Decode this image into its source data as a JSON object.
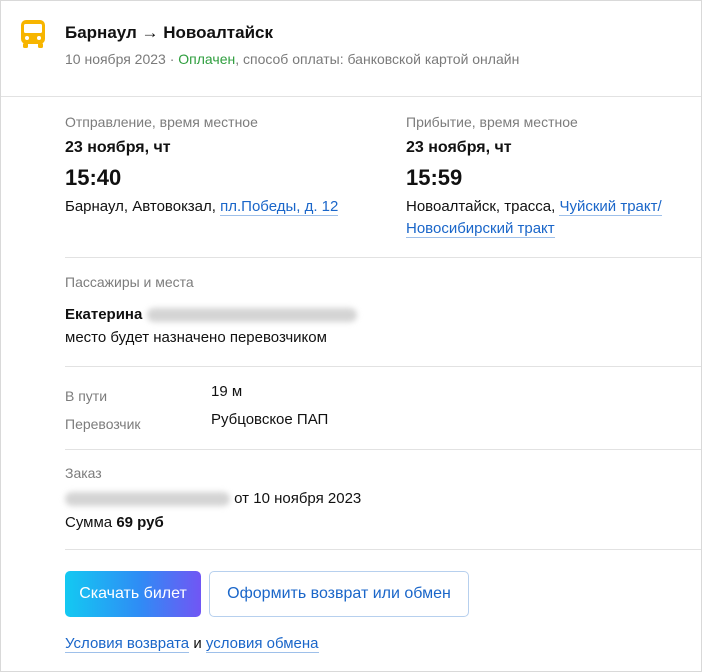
{
  "header": {
    "title": "Барнаул → Новоалтайск",
    "date": "10 ноября 2023",
    "separator": " · ",
    "status": "Оплачен",
    "payment": ", способ оплаты: банковской картой онлайн"
  },
  "departure": {
    "label": "Отправление, время местное",
    "date": "23 ноября, чт",
    "time": "15:40",
    "place_prefix": "Барнаул, Автовокзал, ",
    "place_link": "пл.Победы, д. 12"
  },
  "arrival": {
    "label": "Прибытие, время местное",
    "date": "23 ноября, чт",
    "time": "15:59",
    "place_prefix": "Новоалтайск, трасса, ",
    "place_link_1": "Чуйский тракт/",
    "place_link_2": "Новосибирский тракт"
  },
  "passengers": {
    "label": "Пассажиры и места",
    "name": "Екатерина",
    "seat": "место будет назначено перевозчиком"
  },
  "trip": {
    "duration_label": "В пути",
    "duration_value": "19 м",
    "carrier_label": "Перевозчик",
    "carrier_value": "Рубцовское ПАП"
  },
  "order": {
    "label": "Заказ",
    "date_text": "от 10 ноября 2023",
    "sum_label": "Сумма ",
    "sum_value": "69 руб"
  },
  "actions": {
    "download": "Скачать билет",
    "refund": "Оформить возврат или обмен"
  },
  "footer": {
    "return_conditions": "Условия возврата",
    "and": " и ",
    "exchange_conditions": "условия обмена"
  },
  "colors": {
    "accent_link": "#1a66c9",
    "status_paid": "#2e9e3e",
    "bus_icon": "#f7b500"
  },
  "icons": {
    "bus": "bus-icon"
  }
}
